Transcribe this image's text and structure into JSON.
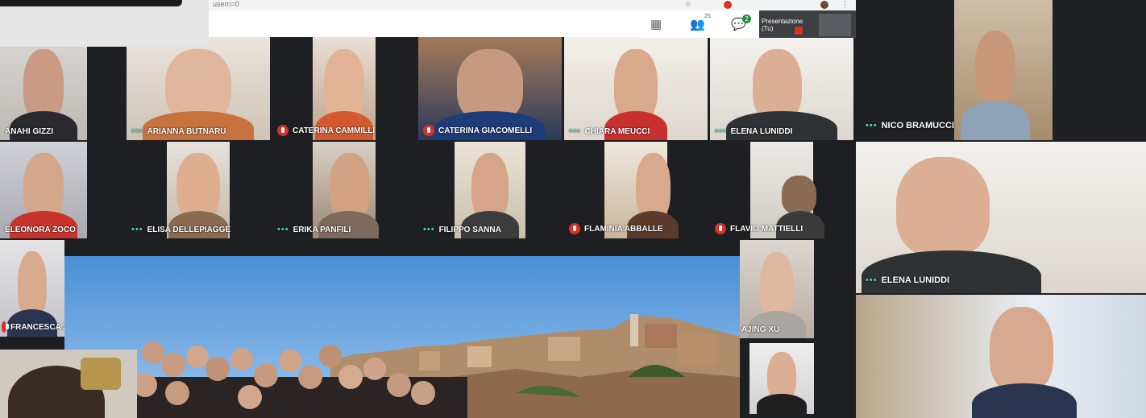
{
  "browser": {
    "url_fragment": "usern=0"
  },
  "toolbar": {
    "grid_icon": "grid-icon",
    "people_icon": "people-icon",
    "people_count": "25",
    "chat_icon": "chat-icon",
    "chat_count": "2",
    "presentation_label": "Presentazione (Tu)"
  },
  "participants": [
    {
      "name": "ANAHI GIZZI",
      "status": "none"
    },
    {
      "name": "ARIANNA BUTNARU",
      "status": "speaking"
    },
    {
      "name": "CATERINA CAMMILLI",
      "status": "muted"
    },
    {
      "name": "CATERINA GIACOMELLI",
      "status": "muted"
    },
    {
      "name": "CHIARA MEUCCI",
      "status": "speaking"
    },
    {
      "name": "ELENA LUNIDDI",
      "status": "speaking"
    },
    {
      "name": "ELEONORA ZOCO",
      "status": "none"
    },
    {
      "name": "ELISA DELLEPIAGGE",
      "status": "speaking"
    },
    {
      "name": "ERIKA PANFILI",
      "status": "speaking"
    },
    {
      "name": "FILIPPO SANNA",
      "status": "speaking"
    },
    {
      "name": "FLAMINIA ABBALLE",
      "status": "muted"
    },
    {
      "name": "FLAVIO MATTIELLI",
      "status": "muted"
    },
    {
      "name": "FRANCESCA ZOL",
      "status": "none"
    },
    {
      "name": "AJING XU",
      "status": "none"
    }
  ],
  "right_panel": {
    "top": {
      "name": "NICO BRAMUCCI"
    },
    "middle": {
      "name": "ELENA LUNIDDI"
    }
  }
}
